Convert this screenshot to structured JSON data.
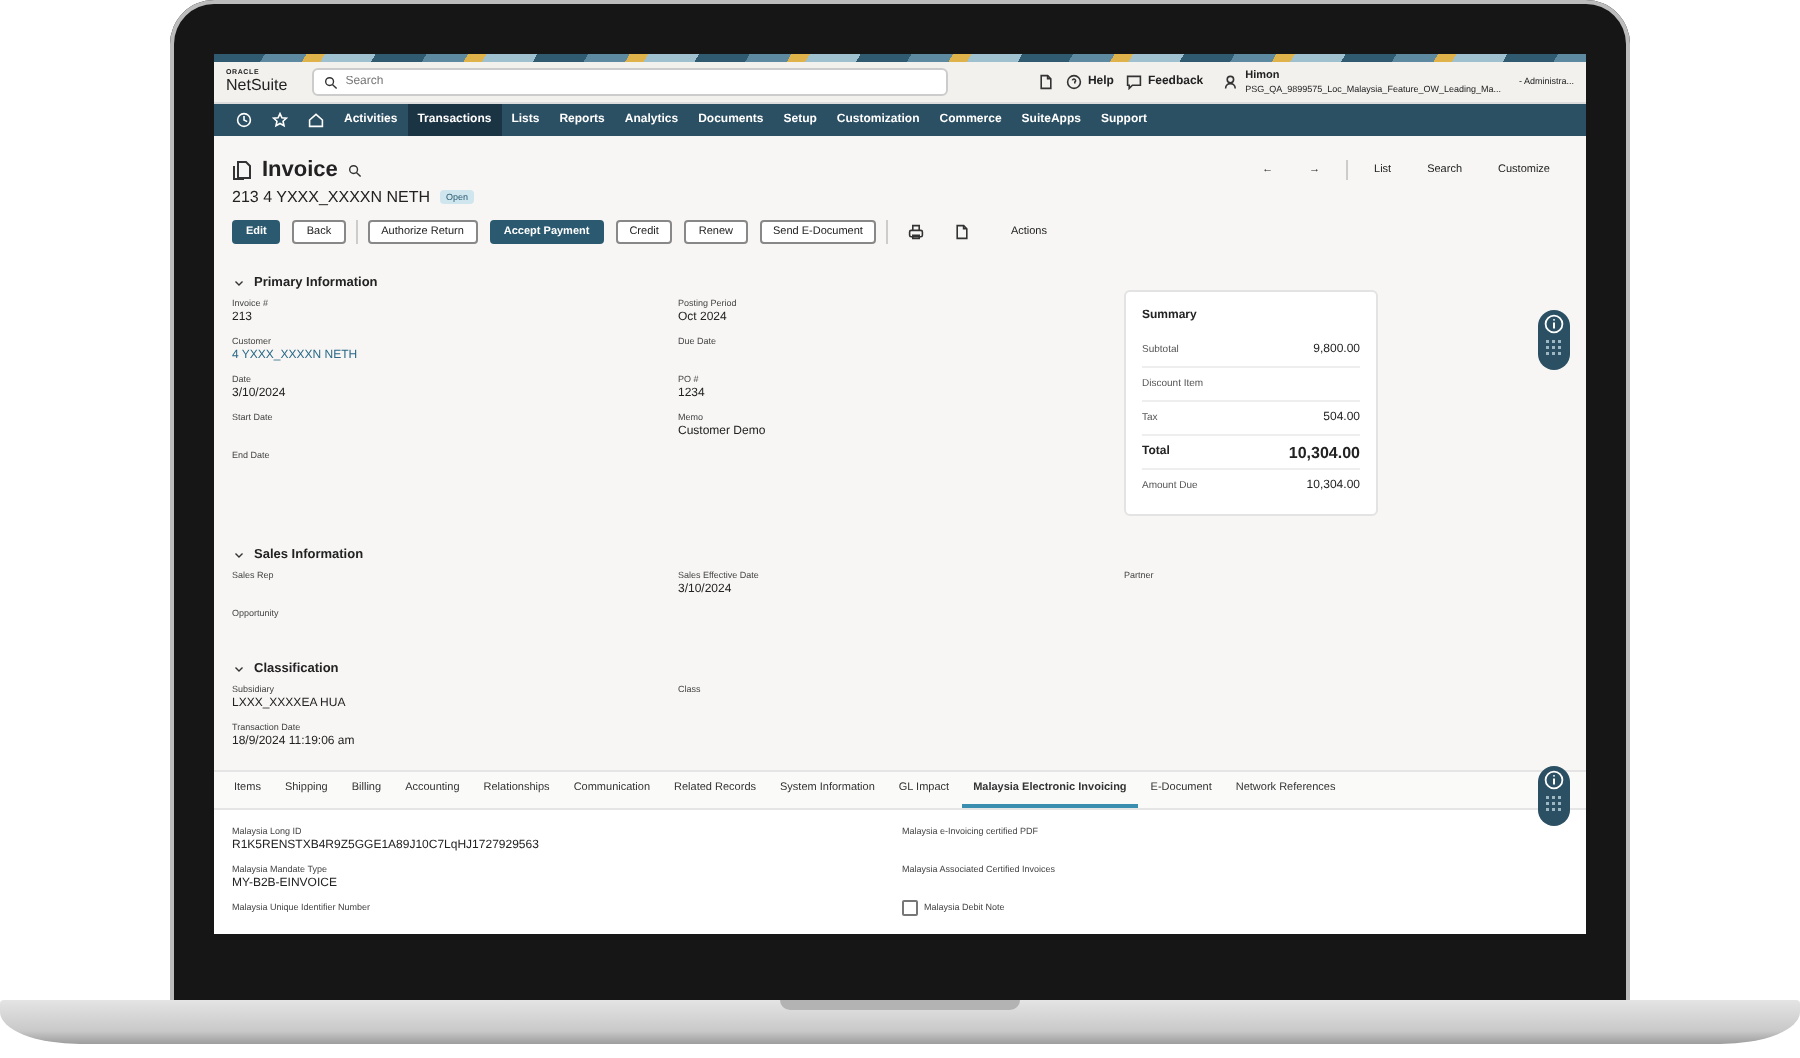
{
  "header": {
    "logo_top": "ORACLE",
    "logo": "NetSuite",
    "search": {
      "placeholder": "Search"
    },
    "help": "Help",
    "feedback": "Feedback",
    "user": {
      "name": "Himon",
      "account": "PSG_QA_9899575_Loc_Malaysia_Feature_OW_Leading_Ma...",
      "role": "- Administra..."
    }
  },
  "nav": [
    {
      "label": "Activities",
      "selected": false
    },
    {
      "label": "Transactions",
      "selected": true
    },
    {
      "label": "Lists",
      "selected": false
    },
    {
      "label": "Reports",
      "selected": false
    },
    {
      "label": "Analytics",
      "selected": false
    },
    {
      "label": "Documents",
      "selected": false
    },
    {
      "label": "Setup",
      "selected": false
    },
    {
      "label": "Customization",
      "selected": false
    },
    {
      "label": "Commerce",
      "selected": false
    },
    {
      "label": "SuiteApps",
      "selected": false
    },
    {
      "label": "Support",
      "selected": false
    }
  ],
  "record": {
    "type": "Invoice",
    "number": "213",
    "name": "4 YXXX_XXXXN NETH",
    "status": "Open"
  },
  "record_nav": {
    "prev": "←",
    "next": "→",
    "links": [
      "List",
      "Search",
      "Customize"
    ]
  },
  "button_groups": [
    [
      {
        "label": "Edit",
        "kind": "primary"
      },
      {
        "label": "Back",
        "kind": "secondary"
      }
    ],
    [
      {
        "label": "Authorize Return",
        "kind": "secondary"
      },
      {
        "label": "Accept Payment",
        "kind": "primary"
      },
      {
        "label": "Credit",
        "kind": "secondary"
      },
      {
        "label": "Renew",
        "kind": "secondary"
      },
      {
        "label": "Send E-Document",
        "kind": "secondary"
      }
    ]
  ],
  "actions": "Actions",
  "sections": [
    {
      "title": "Primary Information",
      "columns": [
        [
          {
            "label": "Invoice #",
            "value": "213"
          },
          {
            "label": "Customer",
            "value": "4 YXXX_XXXXN NETH",
            "kind": "link"
          },
          {
            "label": "Date",
            "value": "3/10/2024"
          },
          {
            "label": "Start Date"
          },
          {
            "label": "End Date"
          }
        ],
        [
          {
            "label": "Posting Period",
            "value": "Oct 2024"
          },
          {
            "label": "Due Date"
          },
          {
            "label": "PO #",
            "value": "1234"
          },
          {
            "label": "Memo",
            "value": "Customer Demo"
          }
        ]
      ]
    },
    {
      "title": "Sales Information",
      "columns": [
        [
          {
            "label": "Sales Rep"
          },
          {
            "label": "Opportunity"
          }
        ],
        [
          {
            "label": "Sales Effective Date",
            "value": "3/10/2024"
          }
        ],
        [
          {
            "label": "Partner"
          }
        ]
      ]
    },
    {
      "title": "Classification",
      "columns": [
        [
          {
            "label": "Subsidiary",
            "value": "LXXX_XXXXEA HUA"
          },
          {
            "label": "Transaction Date",
            "value": "18/9/2024 11:19:06 am"
          }
        ],
        [
          {
            "label": "Class"
          }
        ]
      ]
    }
  ],
  "summary": {
    "title": "Summary",
    "rows": [
      {
        "label": "Subtotal",
        "value": "9,800.00",
        "kind": "normal"
      },
      {
        "label": "Discount Item",
        "kind": "normal"
      },
      {
        "label": "Tax",
        "value": "504.00",
        "kind": "normal"
      },
      {
        "label": "Total",
        "value": "10,304.00",
        "kind": "total"
      },
      {
        "label": "Amount Due",
        "value": "10,304.00",
        "kind": "normal"
      }
    ]
  },
  "tabs": [
    {
      "label": "Items",
      "selected": false
    },
    {
      "label": "Shipping",
      "selected": false
    },
    {
      "label": "Billing",
      "selected": false
    },
    {
      "label": "Accounting",
      "selected": false
    },
    {
      "label": "Relationships",
      "selected": false
    },
    {
      "label": "Communication",
      "selected": false
    },
    {
      "label": "Related Records",
      "selected": false
    },
    {
      "label": "System Information",
      "selected": false
    },
    {
      "label": "GL Impact",
      "selected": false
    },
    {
      "label": "Malaysia Electronic Invoicing",
      "selected": true
    },
    {
      "label": "E-Document",
      "selected": false
    },
    {
      "label": "Network References",
      "selected": false
    }
  ],
  "tab_columns": [
    [
      {
        "label": "Malaysia Long ID",
        "value": "R1K5RENSTXB4R9Z5GGE1A89J10C7LqHJ1727929563"
      },
      {
        "label": "Malaysia Mandate Type",
        "value": "MY-B2B-EINVOICE"
      },
      {
        "label": "Malaysia Unique Identifier Number"
      }
    ],
    [
      {
        "label": "Malaysia e-Invoicing certified PDF"
      },
      {
        "label": "Malaysia Associated Certified Invoices"
      },
      {
        "label": "Malaysia Debit Note",
        "kind": "checkbox",
        "checked": false
      }
    ]
  ]
}
